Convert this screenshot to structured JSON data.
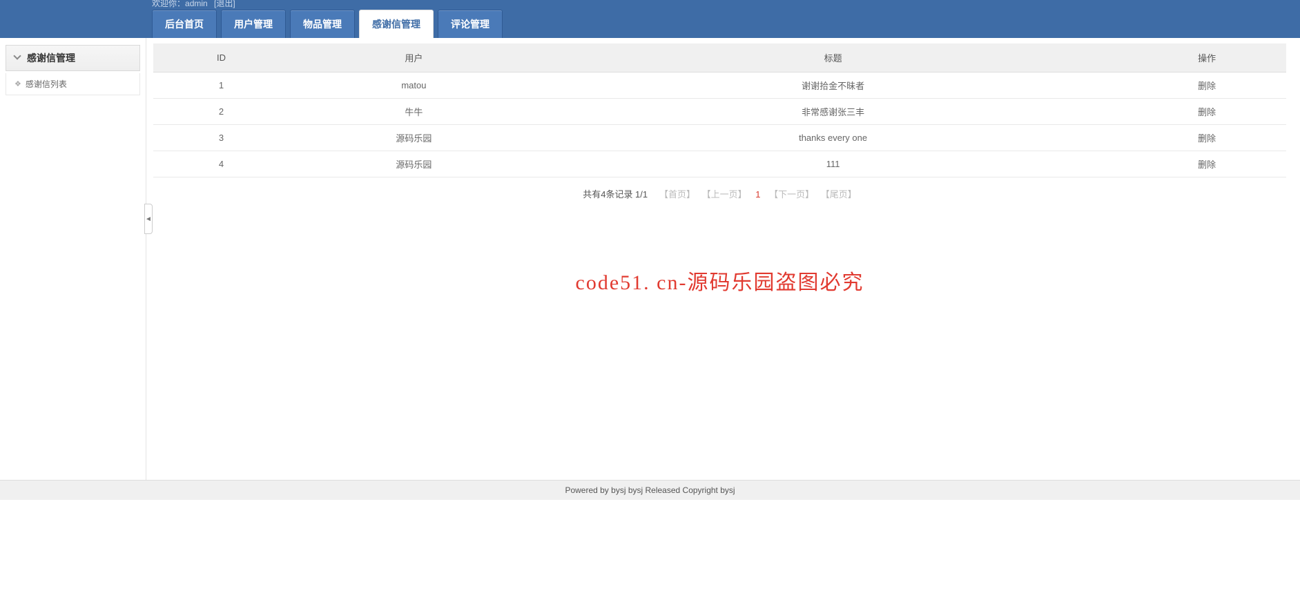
{
  "header": {
    "welcome_prefix": "欢迎你：",
    "username": "admin",
    "logout": "[退出]"
  },
  "nav": [
    {
      "label": "后台首页",
      "active": false
    },
    {
      "label": "用户管理",
      "active": false
    },
    {
      "label": "物品管理",
      "active": false
    },
    {
      "label": "感谢信管理",
      "active": true
    },
    {
      "label": "评论管理",
      "active": false
    }
  ],
  "sidebar": {
    "title": "感谢信管理",
    "items": [
      {
        "label": "感谢信列表"
      }
    ]
  },
  "table": {
    "columns": [
      "ID",
      "用户",
      "标题",
      "操作"
    ],
    "rows": [
      {
        "id": "1",
        "user": "matou",
        "title": "谢谢拾金不昧者",
        "action": "删除"
      },
      {
        "id": "2",
        "user": "牛牛",
        "title": "非常感谢张三丰",
        "action": "删除"
      },
      {
        "id": "3",
        "user": "源码乐园",
        "title": "thanks every one",
        "action": "删除"
      },
      {
        "id": "4",
        "user": "源码乐园",
        "title": "111",
        "action": "删除"
      }
    ]
  },
  "pagination": {
    "summary": "共有4条记录  1/1",
    "first": "【首页】",
    "prev": "【上一页】",
    "current": "1",
    "next": "【下一页】",
    "last": "【尾页】"
  },
  "watermark": "code51. cn-源码乐园盗图必究",
  "footer": "Powered by bysj bysj Released  Copyright bysj"
}
